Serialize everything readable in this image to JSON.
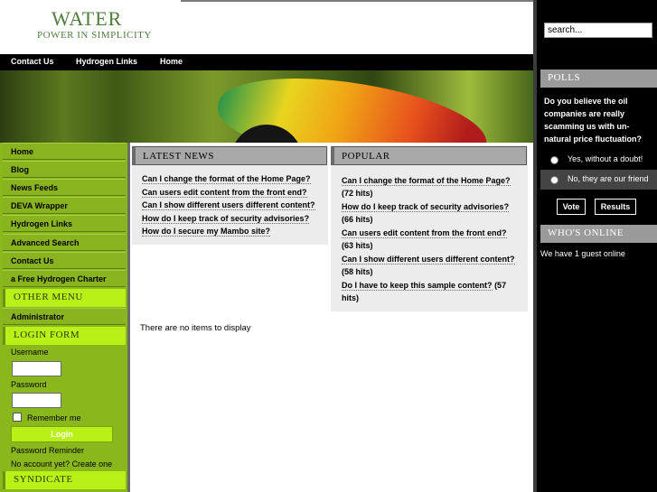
{
  "header": {
    "logo_title": "WATER",
    "logo_subtitle": "POWER IN SIMPLICITY"
  },
  "topnav": {
    "items": [
      "Contact Us",
      "Hydrogen Links",
      "Home"
    ]
  },
  "left_menu": {
    "items": [
      "Home",
      "Blog",
      "News Feeds",
      "DEVA Wrapper",
      "Hydrogen Links",
      "Advanced Search",
      "Contact Us",
      "a Free Hydrogen Charter"
    ],
    "other_menu_title": "OTHER MENU",
    "other_menu_items": [
      "Administrator"
    ],
    "login_title": "LOGIN FORM",
    "username_label": "Username",
    "password_label": "Password",
    "remember_label": "Remember me",
    "login_button": "Login",
    "password_reminder": "Password Reminder",
    "no_account": "No account yet?",
    "create_one": "Create one",
    "syndicate_title": "SYNDICATE"
  },
  "latest_news": {
    "title": "LATEST NEWS",
    "items": [
      "Can I change the format of the Home Page?",
      "Can users edit content from the front end?",
      "Can I show different users different content?",
      "How do I keep track of security advisories?",
      "How do I secure my Mambo site?"
    ]
  },
  "popular": {
    "title": "POPULAR",
    "items": [
      {
        "title": "Can I change the format of the Home Page?",
        "hits": "(72 hits)"
      },
      {
        "title": "How do I keep track of security advisories?",
        "hits": "(66 hits)"
      },
      {
        "title": "Can users edit content from the front end?",
        "hits": "(63 hits)"
      },
      {
        "title": "Can I show different users different content?",
        "hits": "(58 hits)"
      },
      {
        "title": "Do I have to keep this sample content?",
        "hits": "(57 hits)"
      }
    ]
  },
  "content": {
    "no_items": "There are no items to display"
  },
  "right": {
    "search_value": "search...",
    "polls_title": "POLLS",
    "poll_question": "Do you believe the oil companies are really scamming us with un-natural price fluctuation?",
    "poll_options": [
      "Yes, without a doubt!",
      "No, they are our friend"
    ],
    "vote_button": "Vote",
    "results_button": "Results",
    "online_title": "WHO'S ONLINE",
    "online_text": "We have 1 guest online"
  },
  "colors": {
    "sidebar_green": "#89b31f",
    "header_green": "#b8f018",
    "logo_green": "#4f7d3c"
  }
}
